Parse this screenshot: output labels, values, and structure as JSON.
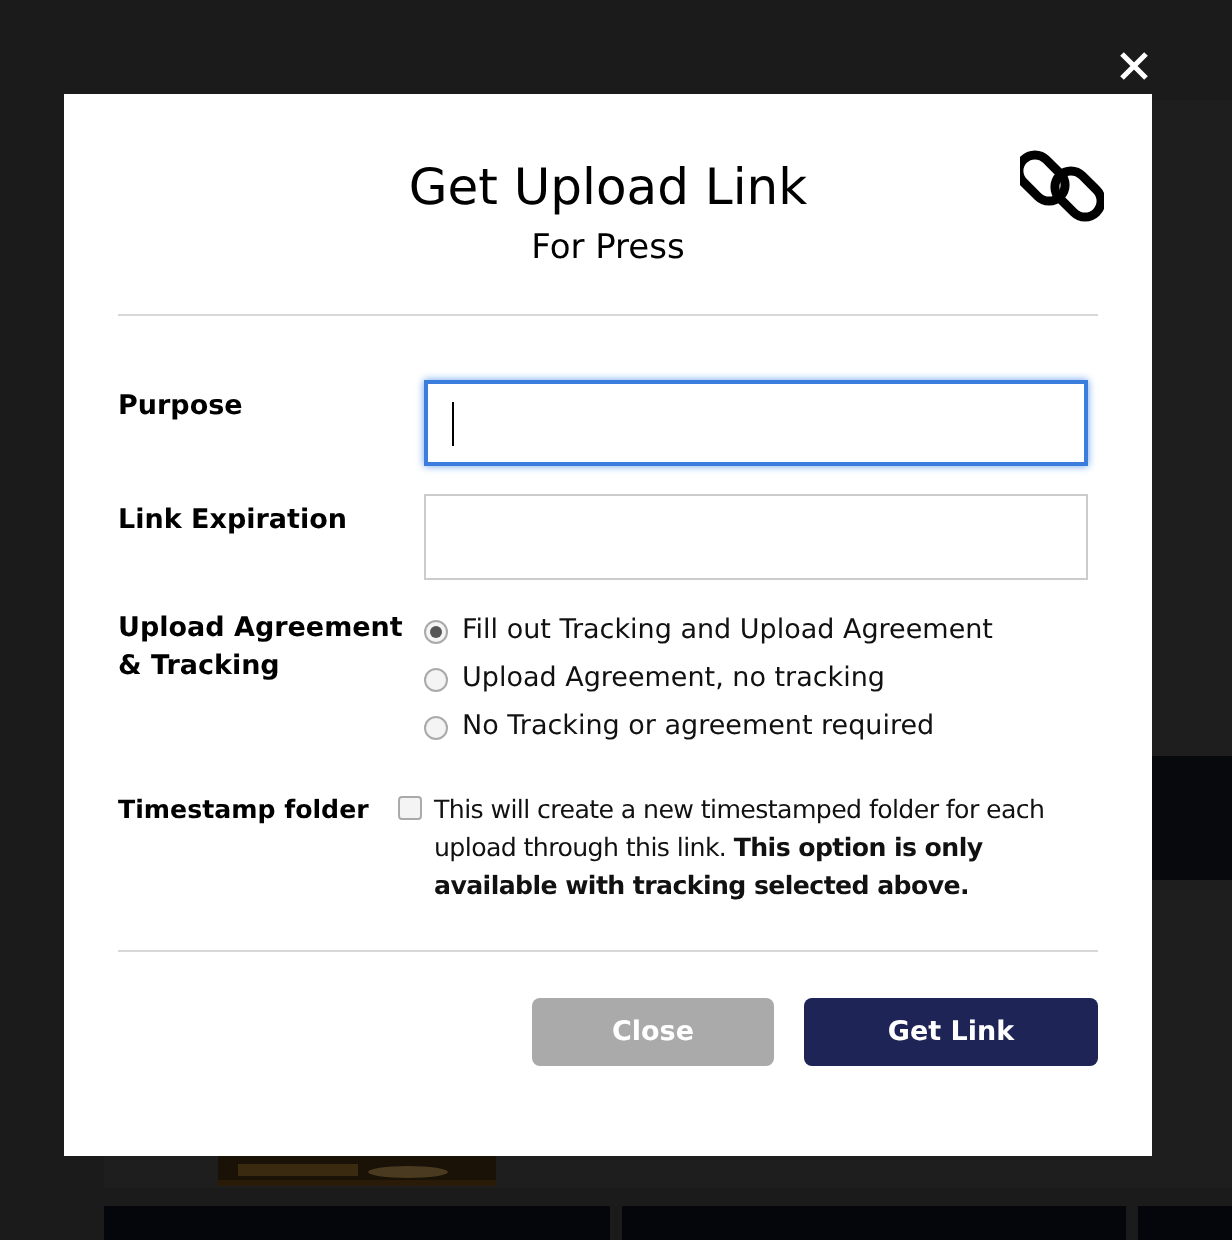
{
  "dialog": {
    "title": "Get Upload Link",
    "subtitle": "For Press",
    "fields": [
      {
        "label": "Purpose",
        "focused": true
      },
      {
        "label": "Link Expiration",
        "focused": false
      }
    ],
    "agreement": {
      "label": "Upload Agreement & Tracking",
      "options": [
        {
          "label": "Fill out Tracking and Upload Agreement",
          "selected": true
        },
        {
          "label": "Upload Agreement, no tracking",
          "selected": false
        },
        {
          "label": "No Tracking or agreement required",
          "selected": false
        }
      ]
    },
    "timestamp": {
      "label": "Timestamp folder",
      "checked": false,
      "text": "This will create a new timestamped folder for each upload through this link. **This option is only available with tracking selected above.**"
    },
    "buttons": [
      {
        "label": "Close",
        "kind": "secondary"
      },
      {
        "label": "Get Link",
        "kind": "primary"
      }
    ]
  }
}
